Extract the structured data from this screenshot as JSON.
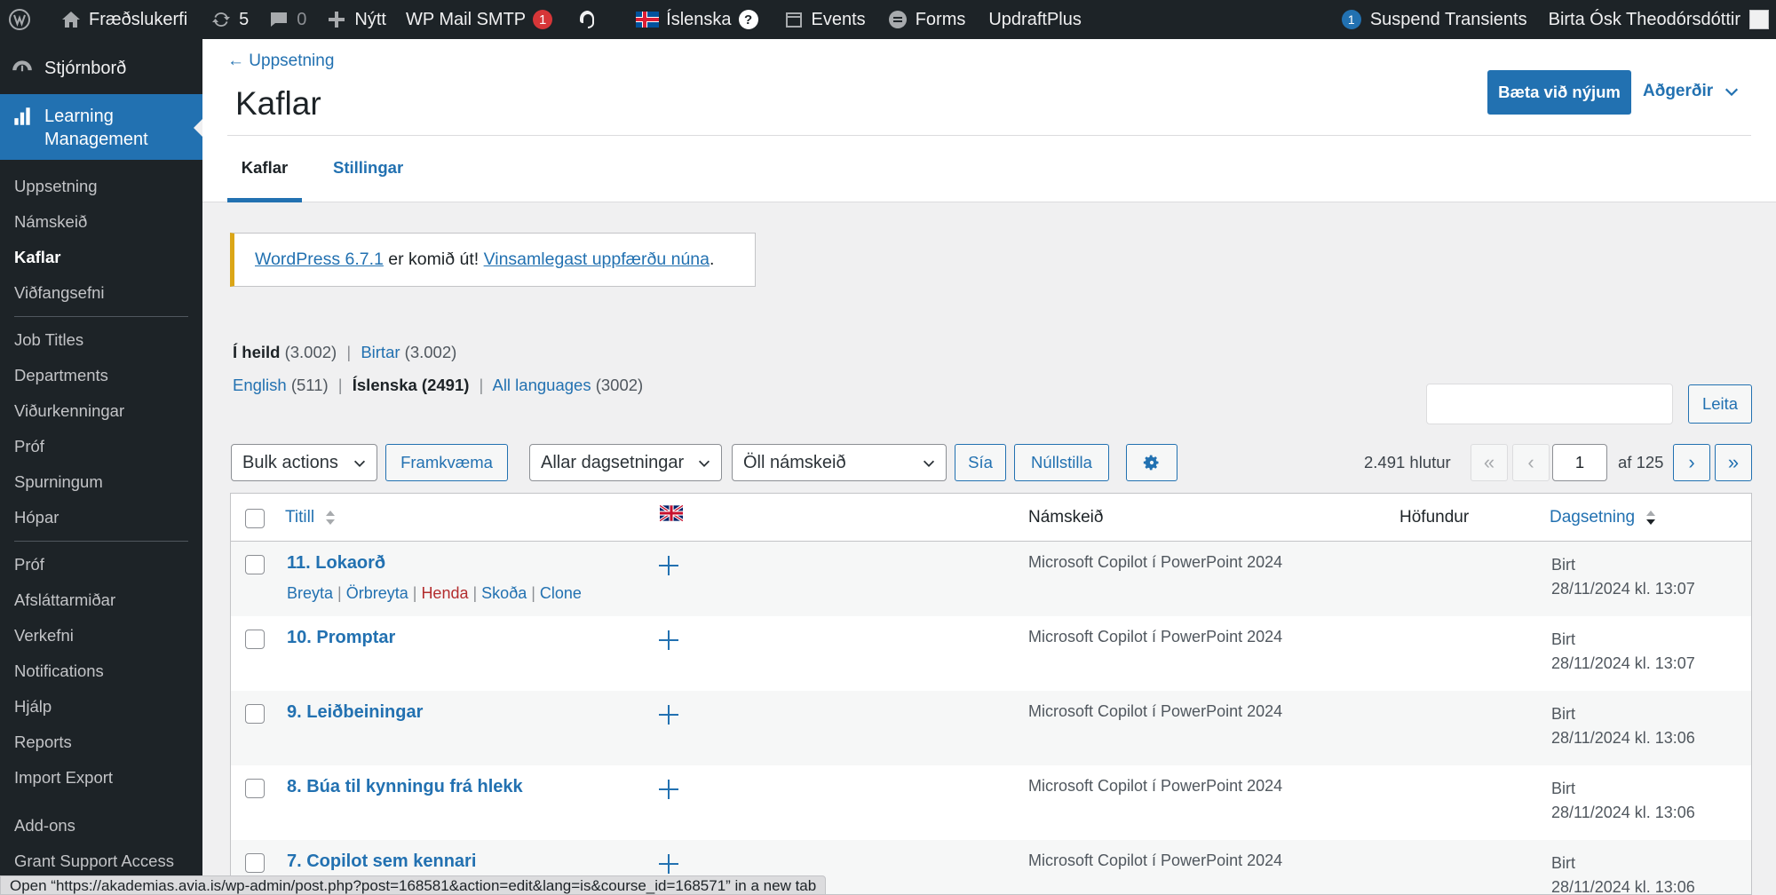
{
  "adminbar": {
    "site_name": "Fræðslukerfi",
    "updates_count": "5",
    "comments_count": "0",
    "new_label": "Nýtt",
    "smtp_label": "WP Mail SMTP",
    "smtp_badge": "1",
    "language_label": "Íslenska",
    "language_help": "?",
    "events_label": "Events",
    "forms_label": "Forms",
    "updraft_label": "UpdraftPlus",
    "transients_badge": "1",
    "transients_label": "Suspend Transients",
    "user_name": "Birta Ósk Theodórsdóttir"
  },
  "sidebar": {
    "dashboard_label": "Stjórnborð",
    "current_menu_label_1": "Learning",
    "current_menu_label_2": "Management",
    "group1": [
      "Uppsetning",
      "Námskeið",
      "Kaflar",
      "Viðfangsefni"
    ],
    "group2": [
      "Job Titles",
      "Departments",
      "Viðurkenningar",
      "Próf",
      "Spurningum",
      "Hópar"
    ],
    "group3": [
      "Próf",
      "Afsláttarmiðar",
      "Verkefni",
      "Notifications",
      "Hjálp",
      "Reports",
      "Import Export"
    ],
    "group4": [
      "Add-ons",
      "Grant Support Access"
    ]
  },
  "header": {
    "back_link": "← Uppsetning",
    "title": "Kaflar",
    "add_new": "Bæta við nýjum",
    "actions": "Aðgerðir",
    "tab_active": "Kaflar",
    "tab_other": "Stillingar"
  },
  "notice": {
    "link1": "WordPress 6.7.1",
    "text": " er komið út! ",
    "link2": "Vinsamlegast uppfærðu núna",
    "end": "."
  },
  "views": {
    "all_label": "Í heild",
    "all_count": "(3.002)",
    "published_label": "Birtar",
    "published_count": "(3.002)",
    "english_label": "English",
    "english_count": "(511)",
    "icelandic_label": "Íslenska (2491)",
    "alllang_label": "All languages",
    "alllang_count": "(3002)"
  },
  "search": {
    "button": "Leita",
    "value": ""
  },
  "tablenav": {
    "bulk_actions": "Bulk actions",
    "apply": "Framkvæma",
    "dates": "Allar dagsetningar",
    "courses": "Öll námskeið",
    "filter": "Sía",
    "reset": "Núllstilla",
    "items": "2.491 hlutur",
    "first": "«",
    "prev": "‹",
    "page": "1",
    "of_pages": "af 125",
    "next": "›",
    "last": "»"
  },
  "table": {
    "col_title": "Titill",
    "col_course": "Námskeið",
    "col_author": "Höfundur",
    "col_date": "Dagsetning",
    "row_actions": [
      "Breyta",
      "Örbreyta",
      "Henda",
      "Skoða",
      "Clone"
    ],
    "rows": [
      {
        "title": "11. Lokaorð",
        "course": "Microsoft Copilot í PowerPoint 2024",
        "status": "Birt",
        "date": "28/11/2024 kl. 13:07"
      },
      {
        "title": "10. Promptar",
        "course": "Microsoft Copilot í PowerPoint 2024",
        "status": "Birt",
        "date": "28/11/2024 kl. 13:07"
      },
      {
        "title": "9. Leiðbeiningar",
        "course": "Microsoft Copilot í PowerPoint 2024",
        "status": "Birt",
        "date": "28/11/2024 kl. 13:06"
      },
      {
        "title": "8. Búa til kynningu frá hlekk",
        "course": "Microsoft Copilot í PowerPoint 2024",
        "status": "Birt",
        "date": "28/11/2024 kl. 13:06"
      },
      {
        "title": "7. Copilot sem kennari",
        "course": "Microsoft Copilot í PowerPoint 2024",
        "status": "Birt",
        "date": "28/11/2024 kl. 13:06"
      }
    ]
  },
  "statusbar": "Open “https://akademias.avia.is/wp-admin/post.php?post=168581&action=edit&lang=is&course_id=168571” in a new tab",
  "colors": {
    "primary": "#2271b1",
    "adminbar": "#1d2327",
    "trash": "#b32d2e",
    "notice_border": "#dba617"
  }
}
